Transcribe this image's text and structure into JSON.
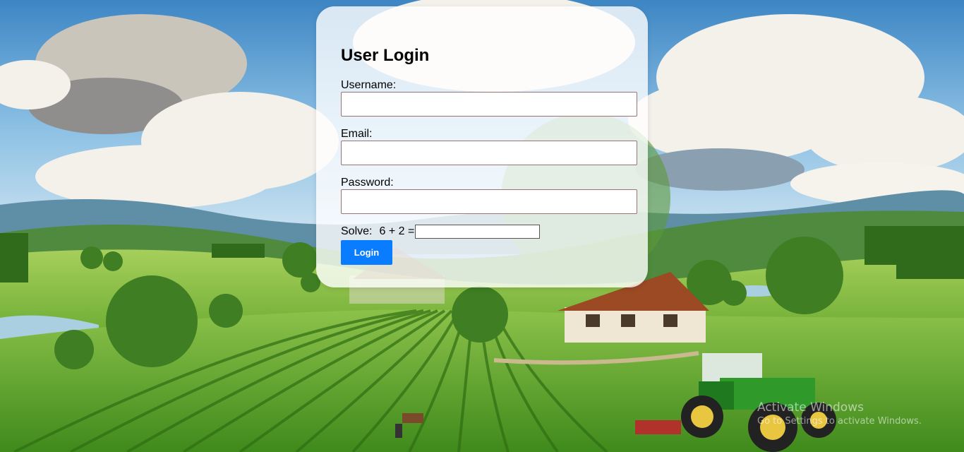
{
  "login": {
    "title": "User Login",
    "username_label": "Username:",
    "username_value": "",
    "email_label": "Email:",
    "email_value": "",
    "password_label": "Password:",
    "password_value": "",
    "captcha_label": "Solve:",
    "captcha_equation": "6 + 2 =",
    "captcha_value": "",
    "submit_label": "Login"
  },
  "watermark": {
    "title": "Activate Windows",
    "subtitle": "Go to Settings to activate Windows."
  },
  "colors": {
    "button": "#0a7cff",
    "field_border": "#9a7474",
    "sky": "#7fb0d8",
    "field_green": "#5f9e2a"
  }
}
